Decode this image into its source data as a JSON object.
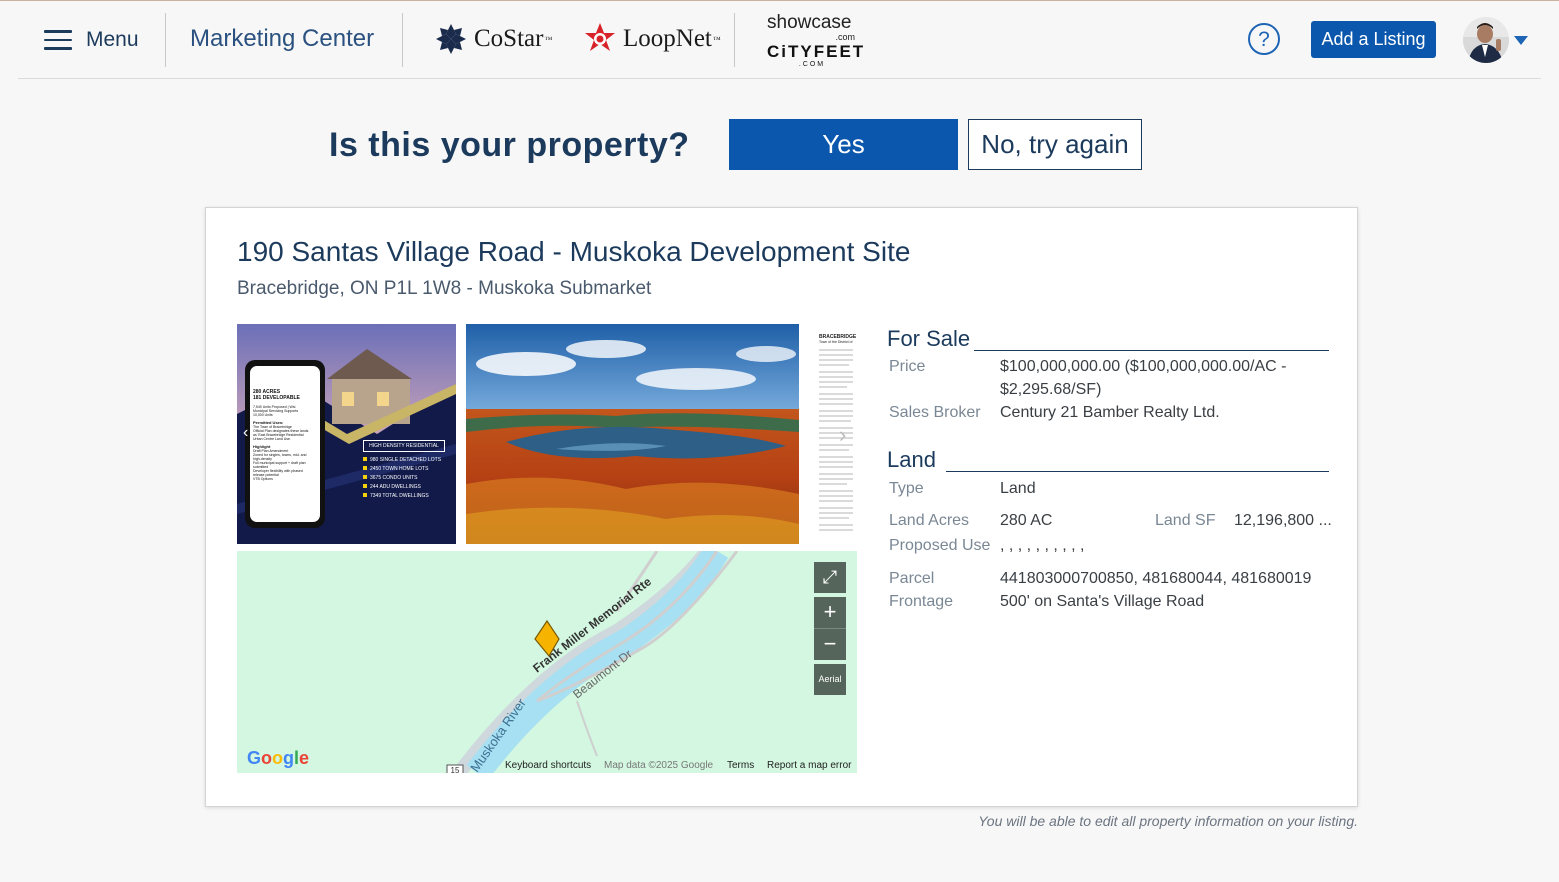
{
  "header": {
    "menu_label": "Menu",
    "marketing_center": "Marketing Center",
    "costar": "CoStar",
    "loopnet": "LoopNet",
    "showcase": "showcase",
    "showcase_com": ".com",
    "cityfeet": "CiTYFEET",
    "cityfeet_com": ".COM",
    "help": "?",
    "add_listing": "Add a Listing"
  },
  "prompt": {
    "question": "Is this your property?",
    "yes": "Yes",
    "no": "No, try again"
  },
  "property": {
    "title": "190 Santas Village Road - Muskoka Development Site",
    "subtitle": "Bracebridge, ON P1L 1W8 - Muskoka Submarket",
    "flyer": {
      "acres": "280 ACRES",
      "developable": "181 DEVELOPABLE",
      "lines": [
        "7,549 Units Proposed | Wsi",
        "Municipal Servicing Supports",
        "10,000 Units"
      ],
      "permitted_title": "Permitted Uses:",
      "permitted_lines": [
        "The Town of Bracebridge",
        "Official Plan designates these lands",
        "as 'East Bracebridge Residential",
        "Urban Centre Land Use."
      ],
      "highlight_title": "Highlight",
      "highlight_lines": [
        "Draft Plan Amendment",
        "Zoned for singles, towns, mid- and",
        "high-density",
        "Full municipal support + draft plan",
        "submitted",
        "Developer flexibility with phased",
        "release potential",
        "VTB Options"
      ],
      "badge": "HIGH DENSITY RESIDENTIAL",
      "stats": [
        "980 SINGLE DETACHED LOTS",
        "2450 TOWN HOME LOTS",
        "3675 CONDO UNITS",
        "244 ADU DWELLINGS",
        "7349 TOTAL DWELLINGS"
      ]
    },
    "doc": {
      "title": "BRACEBRIDGE",
      "subtitle": "Town of the District of"
    }
  },
  "map": {
    "labels": {
      "road1": "Frank Miller Memorial Rte",
      "road2": "Beaumont Dr",
      "river": "Muskoka River",
      "route": "15"
    },
    "controls": {
      "zoom_in": "+",
      "zoom_out": "−",
      "aerial": "Aerial"
    },
    "google": "Google",
    "footer": {
      "shortcuts": "Keyboard shortcuts",
      "mapdata": "Map data ©2025 Google",
      "terms": "Terms",
      "report": "Report a map error"
    }
  },
  "details": {
    "for_sale": {
      "heading": "For Sale",
      "price_label": "Price",
      "price_value_1": "$100,000,000.00 ($100,000,000.00/AC -",
      "price_value_2": "$2,295.68/SF)",
      "broker_label": "Sales Broker",
      "broker_value": "Century 21 Bamber Realty Ltd."
    },
    "land": {
      "heading": "Land",
      "type_label": "Type",
      "type_value": "Land",
      "acres_label": "Land Acres",
      "acres_value": "280 AC",
      "sf_label": "Land SF",
      "sf_value": "12,196,800 ...",
      "use_label": "Proposed Use",
      "use_value": ", , , , , , , , , ,",
      "parcel_label": "Parcel",
      "parcel_value": "441803000700850, 481680044, 481680019",
      "frontage_label": "Frontage",
      "frontage_value": "500' on Santa's Village Road"
    }
  },
  "note": "You will be able to edit all property information on your listing.",
  "colors": {
    "navy": "#1b3a5c",
    "primary_blue": "#0b57ad",
    "map_green": "#d3f7e0",
    "river": "#a0dcf0",
    "pin": "#f6b400"
  }
}
